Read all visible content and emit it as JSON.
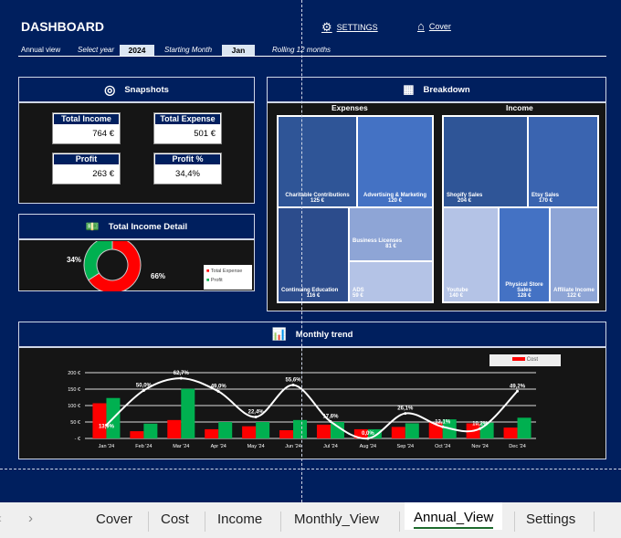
{
  "header": {
    "title": "DASHBOARD",
    "settings_label": "SETTINGS",
    "cover_label": "Cover",
    "annual_view": "Annual view",
    "select_year_label": "Select year",
    "year": "2024",
    "starting_month_label": "Starting Month",
    "month": "Jan",
    "rolling_label": "Rolling 12 months"
  },
  "snapshots": {
    "title": "Snapshots",
    "kpis": [
      {
        "label": "Total Income",
        "value": "764 €"
      },
      {
        "label": "Total Expense",
        "value": "501 €"
      },
      {
        "label": "Profit",
        "value": "263 €"
      },
      {
        "label": "Profit %",
        "value": "34,4%"
      }
    ]
  },
  "income_detail": {
    "title": "Total Income Detail",
    "chart_data": {
      "type": "pie",
      "labels": [
        "Total Expense",
        "Profit"
      ],
      "values": [
        66,
        34
      ],
      "value_labels": [
        "66%",
        "34%"
      ],
      "colors": [
        "#ff0000",
        "#00b050"
      ],
      "legend": "right"
    }
  },
  "breakdown": {
    "title": "Breakdown",
    "expenses_title": "Expenses",
    "income_title": "Income",
    "expenses": [
      {
        "name": "Charitable Contributions",
        "value": "125 €"
      },
      {
        "name": "Advertising & Marketing",
        "value": "120 €"
      },
      {
        "name": "Continuing Education",
        "value": "116 €"
      },
      {
        "name": "Business Licenses",
        "value": "81 €"
      },
      {
        "name": "ADS",
        "value": "59 €"
      }
    ],
    "income": [
      {
        "name": "Shopify Sales",
        "value": "204 €"
      },
      {
        "name": "Etsy Sales",
        "value": "170 €"
      },
      {
        "name": "Youtube",
        "value": "140 €"
      },
      {
        "name": "Physical Store Sales",
        "value": "128 €"
      },
      {
        "name": "Affiliate Income",
        "value": "122 €"
      }
    ]
  },
  "trend": {
    "title": "Monthly trend",
    "chart_data": {
      "type": "bar",
      "categories": [
        "Jan '24",
        "Feb '24",
        "Mar '24",
        "Apr '24",
        "May '24",
        "Jun '24",
        "Jul '24",
        "Aug '24",
        "Sep '24",
        "Oct '24",
        "Nov '24",
        "Dec '24"
      ],
      "series": [
        {
          "name": "Cost",
          "type": "bar",
          "color": "#ff0000",
          "values": [
            107,
            22,
            56,
            28,
            37,
            25,
            42,
            28,
            35,
            48,
            46,
            33
          ]
        },
        {
          "type": "bar",
          "color": "#00b050",
          "values": [
            123,
            45,
            151,
            50,
            50,
            56,
            50,
            28,
            46,
            58,
            48,
            63
          ]
        },
        {
          "type": "line",
          "color": "#ffffff",
          "axis": "secondary",
          "values": [
            13.9,
            50.0,
            62.7,
            49.0,
            22.4,
            55.6,
            17.6,
            0.0,
            26.1,
            12.1,
            10.2,
            49.2
          ],
          "labels": [
            "13,9%",
            "50,0%",
            "62,7%",
            "49,0%",
            "22,4%",
            "55,6%",
            "17,6%",
            "0,0%",
            "26,1%",
            "12,1%",
            "10,2%",
            "49,2%"
          ]
        }
      ],
      "yticks": [
        "- €",
        "50 €",
        "100 €",
        "150 €",
        "200 €"
      ],
      "ylim": [
        0,
        200
      ],
      "y2lim": [
        0,
        68.5
      ],
      "grid": true,
      "legend": "top-right"
    }
  },
  "tabs": [
    "Cover",
    "Cost",
    "Income",
    "Monthly_View",
    "Annual_View",
    "Settings"
  ],
  "active_tab": "Annual_View"
}
